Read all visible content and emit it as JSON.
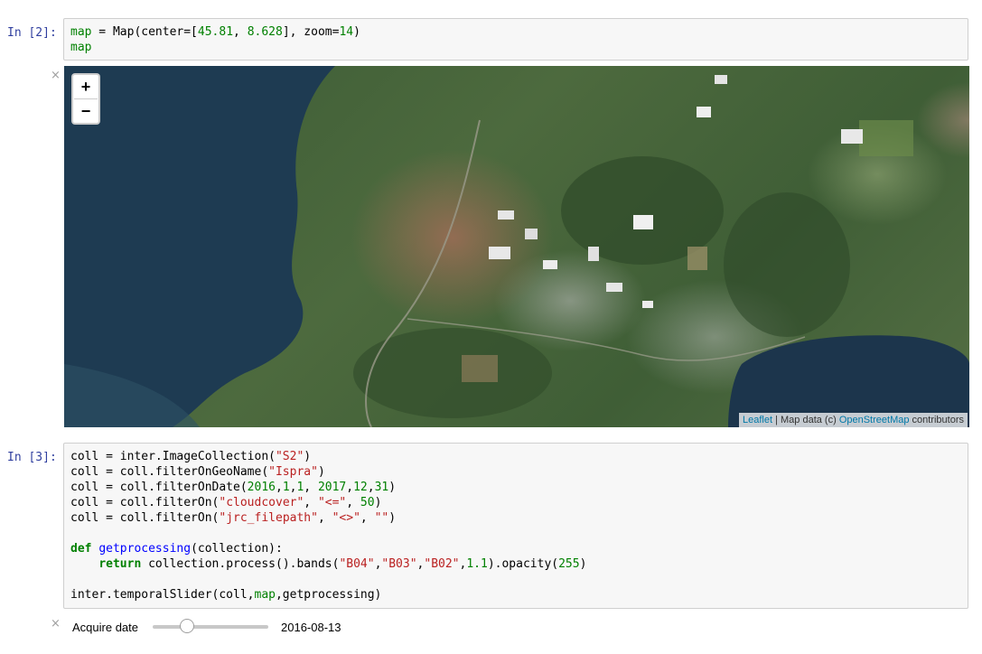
{
  "cell1": {
    "prompt": "In [2]:",
    "lines": [
      [
        {
          "t": "map",
          "c": "var"
        },
        {
          "t": " = Map(center=[",
          "c": ""
        },
        {
          "t": "45.81",
          "c": "num"
        },
        {
          "t": ", ",
          "c": ""
        },
        {
          "t": "8.628",
          "c": "num"
        },
        {
          "t": "], zoom=",
          "c": ""
        },
        {
          "t": "14",
          "c": "num"
        },
        {
          "t": ")",
          "c": ""
        }
      ],
      [
        {
          "t": "map",
          "c": "var"
        }
      ]
    ]
  },
  "output1": {
    "close_symbol": "×",
    "map": {
      "zoom_in_label": "+",
      "zoom_out_label": "−",
      "attribution": {
        "leaflet_link": "Leaflet",
        "separator": " | Map data (c) ",
        "osm_link": "OpenStreetMap",
        "suffix": " contributors"
      }
    }
  },
  "cell2": {
    "prompt": "In [3]:",
    "lines": [
      [
        {
          "t": "coll = inter.ImageCollection(",
          "c": ""
        },
        {
          "t": "\"S2\"",
          "c": "str"
        },
        {
          "t": ")",
          "c": ""
        }
      ],
      [
        {
          "t": "coll = coll.filterOnGeoName(",
          "c": ""
        },
        {
          "t": "\"Ispra\"",
          "c": "str"
        },
        {
          "t": ")",
          "c": ""
        }
      ],
      [
        {
          "t": "coll = coll.filterOnDate(",
          "c": ""
        },
        {
          "t": "2016",
          "c": "num"
        },
        {
          "t": ",",
          "c": ""
        },
        {
          "t": "1",
          "c": "num"
        },
        {
          "t": ",",
          "c": ""
        },
        {
          "t": "1",
          "c": "num"
        },
        {
          "t": ", ",
          "c": ""
        },
        {
          "t": "2017",
          "c": "num"
        },
        {
          "t": ",",
          "c": ""
        },
        {
          "t": "12",
          "c": "num"
        },
        {
          "t": ",",
          "c": ""
        },
        {
          "t": "31",
          "c": "num"
        },
        {
          "t": ")",
          "c": ""
        }
      ],
      [
        {
          "t": "coll = coll.filterOn(",
          "c": ""
        },
        {
          "t": "\"cloudcover\"",
          "c": "str"
        },
        {
          "t": ", ",
          "c": ""
        },
        {
          "t": "\"<=\"",
          "c": "str"
        },
        {
          "t": ", ",
          "c": ""
        },
        {
          "t": "50",
          "c": "num"
        },
        {
          "t": ")",
          "c": ""
        }
      ],
      [
        {
          "t": "coll = coll.filterOn(",
          "c": ""
        },
        {
          "t": "\"jrc_filepath\"",
          "c": "str"
        },
        {
          "t": ", ",
          "c": ""
        },
        {
          "t": "\"<>\"",
          "c": "str"
        },
        {
          "t": ", ",
          "c": ""
        },
        {
          "t": "\"\"",
          "c": "str"
        },
        {
          "t": ")",
          "c": ""
        }
      ],
      [],
      [
        {
          "t": "def",
          "c": "kw"
        },
        {
          "t": " ",
          "c": ""
        },
        {
          "t": "getprocessing",
          "c": "fn"
        },
        {
          "t": "(collection):",
          "c": ""
        }
      ],
      [
        {
          "t": "    ",
          "c": ""
        },
        {
          "t": "return",
          "c": "kw"
        },
        {
          "t": " collection.process().bands(",
          "c": ""
        },
        {
          "t": "\"B04\"",
          "c": "str"
        },
        {
          "t": ",",
          "c": ""
        },
        {
          "t": "\"B03\"",
          "c": "str"
        },
        {
          "t": ",",
          "c": ""
        },
        {
          "t": "\"B02\"",
          "c": "str"
        },
        {
          "t": ",",
          "c": ""
        },
        {
          "t": "1.1",
          "c": "num"
        },
        {
          "t": ").opacity(",
          "c": ""
        },
        {
          "t": "255",
          "c": "num"
        },
        {
          "t": ")",
          "c": ""
        }
      ],
      [],
      [
        {
          "t": "inter.temporalSlider(coll,",
          "c": ""
        },
        {
          "t": "map",
          "c": "var"
        },
        {
          "t": ",getprocessing)",
          "c": ""
        }
      ]
    ]
  },
  "output2": {
    "close_symbol": "×",
    "slider": {
      "label": "Acquire date",
      "value_text": "2016-08-13",
      "fraction": 0.27
    }
  }
}
